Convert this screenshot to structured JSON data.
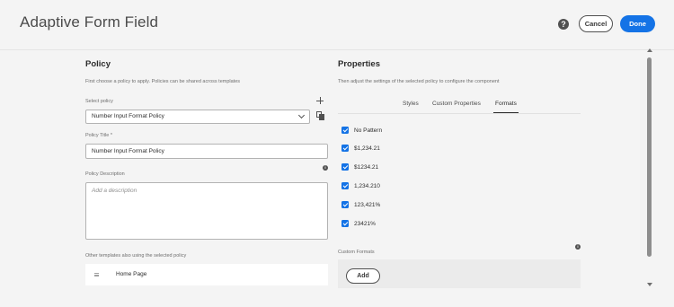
{
  "header": {
    "title": "Adaptive Form Field",
    "help_icon": "help-icon",
    "cancel_label": "Cancel",
    "done_label": "Done",
    "accent_color": "#1473e6"
  },
  "policy": {
    "heading": "Policy",
    "description": "First choose a policy to apply. Policies can be shared across templates",
    "select_label": "Select policy",
    "selected_policy": "Number Input Format Policy",
    "title_label": "Policy Title *",
    "title_value": "Number Input Format Policy",
    "description_label": "Policy Description",
    "description_placeholder": "Add a description",
    "other_templates_label": "Other templates also using the selected policy",
    "templates": [
      {
        "label": "Home Page"
      }
    ]
  },
  "properties": {
    "heading": "Properties",
    "description": "Then adjust the settings of the selected policy to configure the component",
    "tabs": [
      {
        "label": "Styles",
        "active": false
      },
      {
        "label": "Custom Properties",
        "active": false
      },
      {
        "label": "Formats",
        "active": true
      }
    ],
    "formats": [
      {
        "label": "No Pattern",
        "checked": true
      },
      {
        "label": "$1,234.21",
        "checked": true
      },
      {
        "label": "$1234.21",
        "checked": true
      },
      {
        "label": "1,234.210",
        "checked": true
      },
      {
        "label": "123,421%",
        "checked": true
      },
      {
        "label": "23421%",
        "checked": true
      }
    ],
    "custom_formats_label": "Custom Formats",
    "add_label": "Add"
  }
}
